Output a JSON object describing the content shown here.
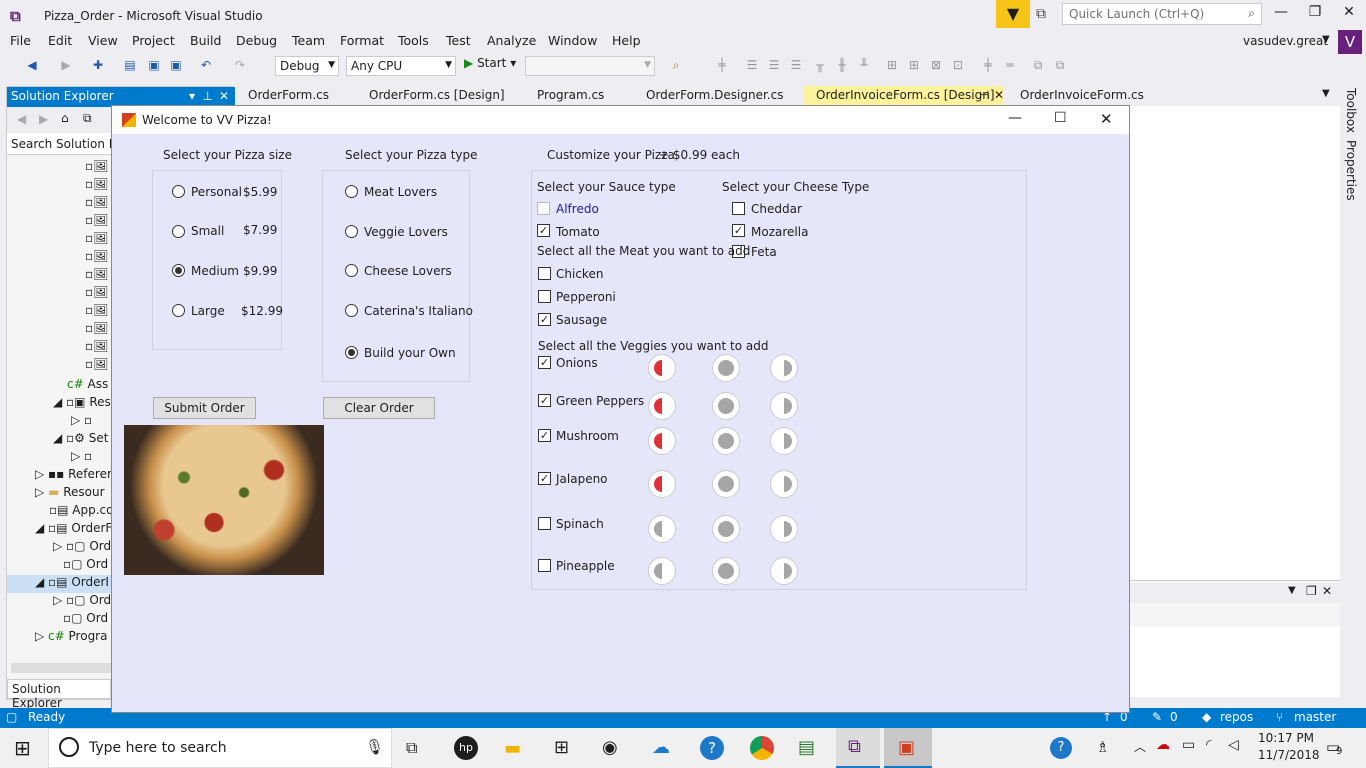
{
  "vs": {
    "title": "Pizza_Order - Microsoft Visual Studio",
    "quick_launch": "Quick Launch (Ctrl+Q)",
    "user": "vasudev.great",
    "badge": "V",
    "menu": [
      "File",
      "Edit",
      "View",
      "Project",
      "Build",
      "Debug",
      "Team",
      "Format",
      "Tools",
      "Test",
      "Analyze",
      "Window",
      "Help"
    ],
    "config": "Debug",
    "platform": "Any CPU",
    "start": "Start",
    "status": "Ready",
    "status_right": {
      "up": "0",
      "edits": "0",
      "repos": "repos",
      "branch": "master"
    }
  },
  "solution_explorer": {
    "title": "Solution Explorer",
    "search": "Search Solution Exp",
    "footer_tab": "Solution Explorer",
    "items": [
      "Ass",
      "Res",
      "Set",
      "Referer",
      "Resour",
      "App.co",
      "OrderF",
      "Ord",
      "Ord",
      "OrderI",
      "Ord",
      "Ord",
      "Progra"
    ]
  },
  "tabs": [
    "OrderForm.cs",
    "OrderForm.cs [Design]",
    "Program.cs",
    "OrderForm.Designer.cs",
    "OrderInvoiceForm.cs [Design]",
    "OrderInvoiceForm.cs"
  ],
  "side": {
    "toolbox": "Toolbox",
    "properties": "Properties"
  },
  "dialog": {
    "title": "Welcome to VV Pizza!",
    "size_heading": "Select your Pizza size",
    "sizes": [
      {
        "label": "Personal",
        "price": "$5.99",
        "selected": false
      },
      {
        "label": "Small",
        "price": "$7.99",
        "selected": false
      },
      {
        "label": "Medium",
        "price": "$9.99",
        "selected": true
      },
      {
        "label": "Large",
        "price": "$12.99",
        "selected": false
      }
    ],
    "type_heading": "Select your Pizza type",
    "types": [
      {
        "label": "Meat Lovers",
        "selected": false
      },
      {
        "label": "Veggie Lovers",
        "selected": false
      },
      {
        "label": "Cheese Lovers",
        "selected": false
      },
      {
        "label": "Caterina's Italiano",
        "selected": false
      },
      {
        "label": "Build your Own",
        "selected": true
      }
    ],
    "customize_heading": "Customize your Pizza",
    "customize_price": "+ $0.99 each",
    "sauce_heading": "Select your Sauce type",
    "sauces": [
      {
        "label": "Alfredo",
        "checked": false,
        "disabled": true
      },
      {
        "label": "Tomato",
        "checked": true,
        "disabled": false
      }
    ],
    "cheese_heading": "Select your Cheese Type",
    "cheeses": [
      {
        "label": "Cheddar",
        "checked": false
      },
      {
        "label": "Mozarella",
        "checked": true
      },
      {
        "label": "Feta",
        "checked": false
      }
    ],
    "meat_heading": "Select all the Meat you want to add",
    "meats": [
      {
        "label": "Chicken",
        "checked": false
      },
      {
        "label": "Pepperoni",
        "checked": false
      },
      {
        "label": "Sausage",
        "checked": true
      }
    ],
    "veggie_heading": "Select all the Veggies you want to add",
    "veggies": [
      {
        "label": "Onions",
        "checked": true
      },
      {
        "label": "Green Peppers",
        "checked": true
      },
      {
        "label": "Mushroom",
        "checked": true
      },
      {
        "label": "Jalapeno",
        "checked": true
      },
      {
        "label": "Spinach",
        "checked": false
      },
      {
        "label": "Pineapple",
        "checked": false
      }
    ],
    "submit": "Submit Order",
    "clear": "Clear Order",
    "accent_red": "#e0303a",
    "gray": "#a6a6a6"
  },
  "taskbar": {
    "search": "Type here to search",
    "time": "10:17 PM",
    "date": "11/7/2018",
    "notif_count": "9"
  }
}
